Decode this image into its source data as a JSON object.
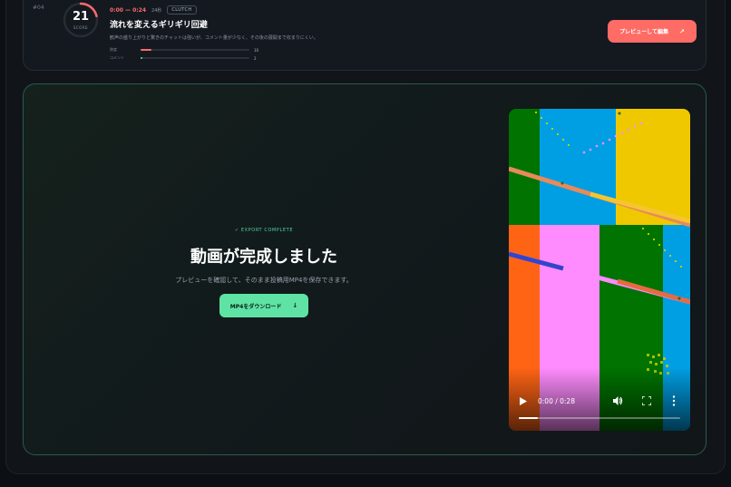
{
  "clip": {
    "index": "#04",
    "score": "21",
    "score_label": "SCORE",
    "time_range": "0:00 — 0:24",
    "duration": "24秒",
    "tag": "CLUTCH",
    "title": "流れを変えるギリギリ回避",
    "description": "歓声の盛り上がりと驚きのチャットは強いが、コメント量が少なく、その後の展開まで収まりにくい。",
    "metrics": [
      {
        "label": "熱度",
        "value": "10",
        "fill": 0.1,
        "color": "#ff6b6b"
      },
      {
        "label": "コメント",
        "value": "2",
        "fill": 0.02,
        "color": "#5ee3a4"
      }
    ],
    "preview_button": "プレビューして編集",
    "preview_arrow": "↗"
  },
  "export": {
    "badge": "✓ EXPORT COMPLETE",
    "heading": "動画が完成しました",
    "subtext": "プレビューを確認して、そのまま投稿用MP4を保存できます。",
    "download_button": "MP4をダウンロード",
    "download_arrow": "↓"
  },
  "video": {
    "time": "0:00 / 0:28",
    "progress": 0.12,
    "icons": [
      "play-icon",
      "volume-icon",
      "fullscreen-icon",
      "more-icon"
    ]
  },
  "colors": {
    "accent_red": "#ff6b65",
    "accent_green": "#5ee3a4",
    "background": "#0c0f13"
  }
}
